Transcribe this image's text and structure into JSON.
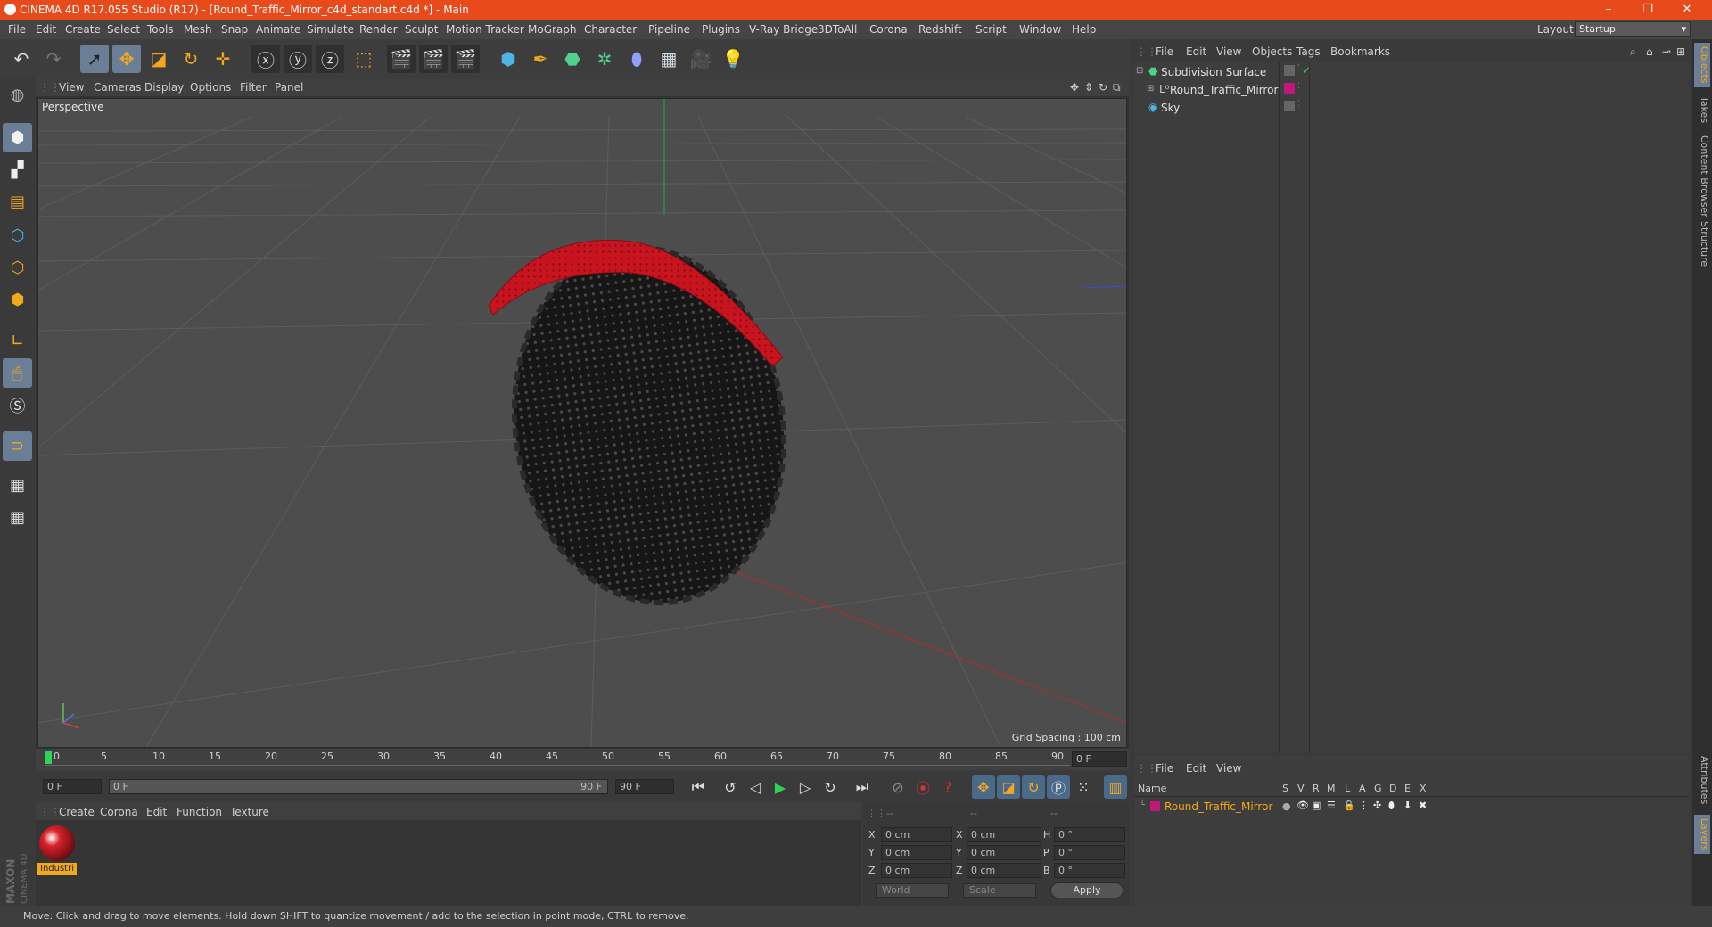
{
  "window": {
    "title": "CINEMA 4D R17.055 Studio (R17) - [Round_Traffic_Mirror_c4d_standart.c4d *] - Main",
    "minimize": "–",
    "restore": "❐",
    "close": "✕"
  },
  "menubar": {
    "items": [
      "File",
      "Edit",
      "Create",
      "Select",
      "Tools",
      "Mesh",
      "Snap",
      "Animate",
      "Simulate",
      "Render",
      "Sculpt",
      "Motion Tracker",
      "MoGraph",
      "Character",
      "Pipeline",
      "Plugins",
      "V-Ray Bridge",
      "3DToAll",
      "Corona",
      "Redshift",
      "Script",
      "Window",
      "Help"
    ],
    "layout_label": "Layout:",
    "layout_value": "Startup"
  },
  "viewport": {
    "menu": [
      "View",
      "Cameras",
      "Display",
      "Options",
      "Filter",
      "Panel"
    ],
    "label": "Perspective",
    "grid_spacing": "Grid Spacing : 100 cm"
  },
  "timeline": {
    "ticks": [
      "0",
      "5",
      "10",
      "15",
      "20",
      "25",
      "30",
      "35",
      "40",
      "45",
      "50",
      "55",
      "60",
      "65",
      "70",
      "75",
      "80",
      "85",
      "90"
    ],
    "current_frame": "0 F"
  },
  "transport": {
    "start_field": "0 F",
    "range_start": "0 F",
    "range_end": "90 F",
    "end_field": "90 F"
  },
  "material_panel": {
    "menu": [
      "Create",
      "Corona",
      "Edit",
      "Function",
      "Texture"
    ],
    "material_name": "Industri"
  },
  "coords": {
    "header": [
      "--",
      "--",
      "--"
    ],
    "rows": [
      {
        "a": "X",
        "av": "0 cm",
        "b": "X",
        "bv": "0 cm",
        "c": "H",
        "cv": "0 °"
      },
      {
        "a": "Y",
        "av": "0 cm",
        "b": "Y",
        "bv": "0 cm",
        "c": "P",
        "cv": "0 °"
      },
      {
        "a": "Z",
        "av": "0 cm",
        "b": "Z",
        "bv": "0 cm",
        "c": "B",
        "cv": "0 °"
      }
    ],
    "space": "World",
    "mode": "Scale",
    "apply": "Apply"
  },
  "object_manager": {
    "menu": [
      "File",
      "Edit",
      "View",
      "Objects",
      "Tags",
      "Bookmarks"
    ],
    "objects": [
      {
        "name": "Subdivision Surface"
      },
      {
        "name": "Round_Traffic_Mirror"
      },
      {
        "name": "Sky"
      }
    ]
  },
  "layer_manager": {
    "menu": [
      "File",
      "Edit",
      "View"
    ],
    "columns": [
      "Name",
      "S",
      "V",
      "R",
      "M",
      "L",
      "A",
      "G",
      "D",
      "E",
      "X"
    ],
    "layer_name": "Round_Traffic_Mirror"
  },
  "side_tabs": [
    "Objects",
    "Takes",
    "Content Browser",
    "Structure",
    "Attributes",
    "Layers"
  ],
  "status": "Move: Click and drag to move elements. Hold down SHIFT to quantize movement / add to the selection in point mode, CTRL to remove.",
  "colors": {
    "title_bar": "#e84a1c",
    "accent_selected": "#6a7f96",
    "layer_color": "#c2187a",
    "mirror_red": "#c8141e"
  }
}
